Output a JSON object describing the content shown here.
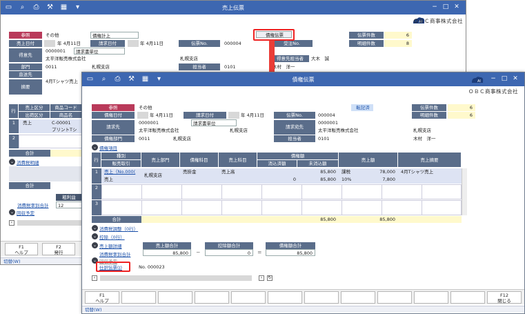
{
  "back": {
    "title": "売上伝票",
    "company": "ＯＢＣ商事株式会社",
    "label_sanshou": "参照",
    "sanshou_value": "その他",
    "shurui_value": "債権計上",
    "label_uriage_date": "売上日付",
    "uriage_date": "年  4月11日",
    "label_seikyu_date": "請求日付",
    "seikyu_date": "年  4月11日",
    "label_denpyo_no": "伝票No.",
    "denpyo_no": "000004",
    "label_juchu_no": "受注No.",
    "saiken_button": "債権伝票",
    "label_denpyo_count": "伝票件数",
    "denpyo_count": "6",
    "label_meisai_count": "明細件数",
    "meisai_count": "8",
    "label_tokuisaki": "得意先",
    "tokuisaki_code": "0000001",
    "seikyu_tani": "請求書単位",
    "tokuisaki_name": "太平洋販売株式会社",
    "tokuisaki_branch": "札幌支店",
    "label_tokuisaki_tanto": "得意先担当者",
    "tokuisaki_tanto": "大木　誠",
    "label_bumon": "部門",
    "bumon_code": "0011",
    "bumon_name": "札幌支店",
    "label_tantosha": "担当者",
    "tanto_code": "0101",
    "tanto_name": "木村　洋一",
    "label_chokusosaki": "直送先",
    "label_tekiyo": "摘要",
    "tekiyo": "4月Tシャツ売上",
    "col_gyo": "行",
    "col_uriage_kubun": "売上区分",
    "col_shukka_kubun": "出荷区分",
    "col_shohin_code": "商品コード",
    "col_shohin_mei": "商品名",
    "row1_no": "1",
    "row1_kubun": "売上",
    "row1_code": "C-00001",
    "row1_name": "プリントTシ",
    "row2_no": "2",
    "label_gokei": "合計",
    "shohizei_meisai": "消費税明細",
    "label_gokei2": "合計",
    "label_arari": "粗利益",
    "shohizei_rate_gokei": "消費税率別合計",
    "shohizei_rate_value": "12",
    "kaishu_yotei": "回収予定",
    "f1": "F1",
    "f1_label": "ヘルプ",
    "f2": "F2",
    "f2_label": "発行",
    "switch_label": "切替(W)"
  },
  "front": {
    "title": "債権伝票",
    "company": "ＯＢＣ商事株式会社",
    "label_sanshou": "参照",
    "sanshou_value": "その他",
    "tenkizumi": "転記済",
    "label_denpyo_count": "伝票件数",
    "denpyo_count": "6",
    "label_meisai_count": "明細件数",
    "meisai_count": "6",
    "label_saiken_date": "債権日付",
    "saiken_date": "年  4月11日",
    "label_seikyu_date": "請求日付",
    "seikyu_date": "年  4月11日",
    "label_denpyo_no": "伝票No.",
    "denpyo_no": "000004",
    "label_seikyusaki": "請求先",
    "seikyusaki_code": "0000001",
    "seikyu_tani": "請求書単位",
    "seikyusaki_name": "太平洋販売株式会社",
    "seikyusaki_branch": "札幌支店",
    "label_seikyu_atesaki": "請求宛先",
    "atesaki_code": "0000001",
    "atesaki_name": "太平洋販売株式会社",
    "atesaki_branch": "札幌支店",
    "label_saiken_bumon": "債権部門",
    "bumon_code": "0011",
    "bumon_name": "札幌支店",
    "label_tantosha": "担当者",
    "tanto_code": "0101",
    "tanto_name": "木村　洋一",
    "saiken_komoku": "債権項目",
    "col_gyo": "行",
    "col_shubetsu": "種別",
    "col_hanbai_torihiki": "販売取引",
    "col_uriage_bumon": "売上部門",
    "col_saiken_kamoku": "債権科目",
    "col_uriage_kamoku": "売上科目",
    "col_saiken_gaku": "債権額",
    "col_shohi_zumi": "消込済額",
    "col_mi_shohi": "未消込額",
    "col_uriage_gaku": "売上額",
    "col_uriage_tekiyo": "売上摘要",
    "row1_no": "1",
    "row1_shubetsu": "売上（No.000(",
    "row1_torihiki": "売上",
    "row1_bumon": "札幌支店",
    "row1_saiken_kamoku": "売掛金",
    "row1_uriage_kamoku": "売上高",
    "row1_shohi_zumi": "0",
    "row1_saiken_top": "85,800",
    "row1_mi_shohi": "85,800",
    "row1_zei": "課税",
    "row1_rate": "10%",
    "row1_uriage": "78,000",
    "row1_tax": "7,800",
    "row1_tekiyo": "4月Tシャツ売上",
    "row2_no": "2",
    "row3_no": "3",
    "label_gokei": "合計",
    "gokei_saiken": "85,800",
    "gokei_uriage": "85,800",
    "shohizei_chosei": "消費税調整（0行）",
    "kojo": "控除（0行）",
    "uriage_gaku_meisai": "売上額詳細",
    "shohizei_rate_gokei": "消費税率別合計",
    "label_uriage_gokei": "売上額合計",
    "uriage_gokei": "85,800",
    "op_minus": "－",
    "label_kojo_gokei": "控除額合計",
    "kojo_gokei": "0",
    "op_eq": "＝",
    "label_saiken_gokei": "債権額合計",
    "saiken_gokei": "85,800",
    "kaishu_yotei": "回収予定",
    "shiwake_denpyo": "仕訳伝票(J)",
    "shiwake_no": "No. 000023",
    "f1": "F1",
    "f1_label": "ヘルプ",
    "f12": "F12",
    "f12_label": "閉じる",
    "switch_label": "切替(W)"
  }
}
